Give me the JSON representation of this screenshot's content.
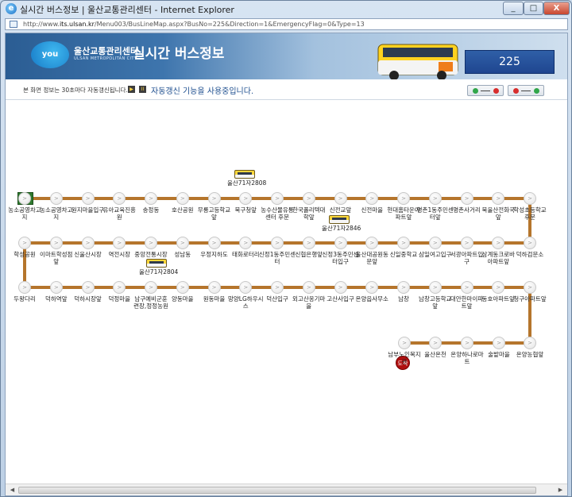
{
  "window": {
    "title": "실시간 버스정보 | 울산교통관리센터 - Internet Explorer",
    "close_label": "X"
  },
  "address": {
    "prefix": "http://www.",
    "domain": "its.ulsan.kr",
    "path": "/Menu003/BusLineMap.aspx?BusNo=225&Direction=1&EmergencyFlag=0&Type=13"
  },
  "header": {
    "logo_text": "you",
    "org_name": "울산교통관리센터",
    "org_sub": "ULSAN METROPOLITAN CITY",
    "page_title": "실시간 버스정보",
    "bus_number": "225"
  },
  "infobar": {
    "auto_note": "본 화면 정보는 30초마다 자동갱신됩니다.",
    "auto_status": "자동갱신 기능을 사용중입니다.",
    "play": "▶",
    "pause": "II"
  },
  "badges": {
    "start": "출발",
    "end": "도착"
  },
  "stop_glyph": ">",
  "row1": [
    {
      "name": "농소공영차고지"
    },
    {
      "name": "농소공영차고지"
    },
    {
      "name": "원지마을입구"
    },
    {
      "name": "유아교육진흥원"
    },
    {
      "name": "송정동"
    },
    {
      "name": "호산공원"
    },
    {
      "name": "무룡고등학교앞"
    },
    {
      "name": "북구청앞"
    },
    {
      "name": "농수산물유통센터 후문"
    },
    {
      "name": "한국폴리텍대학앞"
    },
    {
      "name": "신전교앞"
    },
    {
      "name": "신전마을"
    },
    {
      "name": "현대홈타운아파트앞"
    },
    {
      "name": "명촌1동주민센터앞"
    },
    {
      "name": "명촌사거리"
    },
    {
      "name": "북울산전화국앞"
    },
    {
      "name": "학성초등학교후문"
    }
  ],
  "row2": [
    {
      "name": "학성공원"
    },
    {
      "name": "이마트학성점앞"
    },
    {
      "name": "신울산시장"
    },
    {
      "name": "역전시장"
    },
    {
      "name": "중앙전통시장"
    },
    {
      "name": "성남동"
    },
    {
      "name": "우정지하도"
    },
    {
      "name": "태화로터리"
    },
    {
      "name": "신정1동주민센터"
    },
    {
      "name": "신협은행앞"
    },
    {
      "name": "신정3동주민센터입구"
    },
    {
      "name": "울산대공원동문앞"
    },
    {
      "name": "신일중학교"
    },
    {
      "name": "삼일여고입구"
    },
    {
      "name": "서광아파트입구"
    },
    {
      "name": "삼계동크로바아파트앞"
    },
    {
      "name": "덕하검문소"
    }
  ],
  "row3": [
    {
      "name": "두왕다리"
    },
    {
      "name": "덕하역앞"
    },
    {
      "name": "덕하시장앞"
    },
    {
      "name": "덕정마을"
    },
    {
      "name": "남구예비군훈련장,정정농원"
    },
    {
      "name": "양동마을"
    },
    {
      "name": "원동마을"
    },
    {
      "name": "망양LG하우시스"
    },
    {
      "name": "덕산입구"
    },
    {
      "name": "외고산옹기마을"
    },
    {
      "name": "고산사입구"
    },
    {
      "name": "온양읍사무소"
    },
    {
      "name": "남창"
    },
    {
      "name": "남창고등학교앞"
    },
    {
      "name": "대안한마이파트앞"
    },
    {
      "name": "동호아파트앞"
    },
    {
      "name": "청구아파트앞"
    }
  ],
  "row4": [
    {
      "name": "온양농협앞"
    },
    {
      "name": "술밭마을"
    },
    {
      "name": "온양하나로마트"
    },
    {
      "name": "울산온천"
    },
    {
      "name": "남부노인복지관"
    }
  ],
  "buses": [
    {
      "label": "울산71자2808"
    },
    {
      "label": "울산71자2846"
    },
    {
      "label": "울산71자2804"
    }
  ],
  "scrollbar": {
    "left": "◀",
    "right": "▶"
  }
}
